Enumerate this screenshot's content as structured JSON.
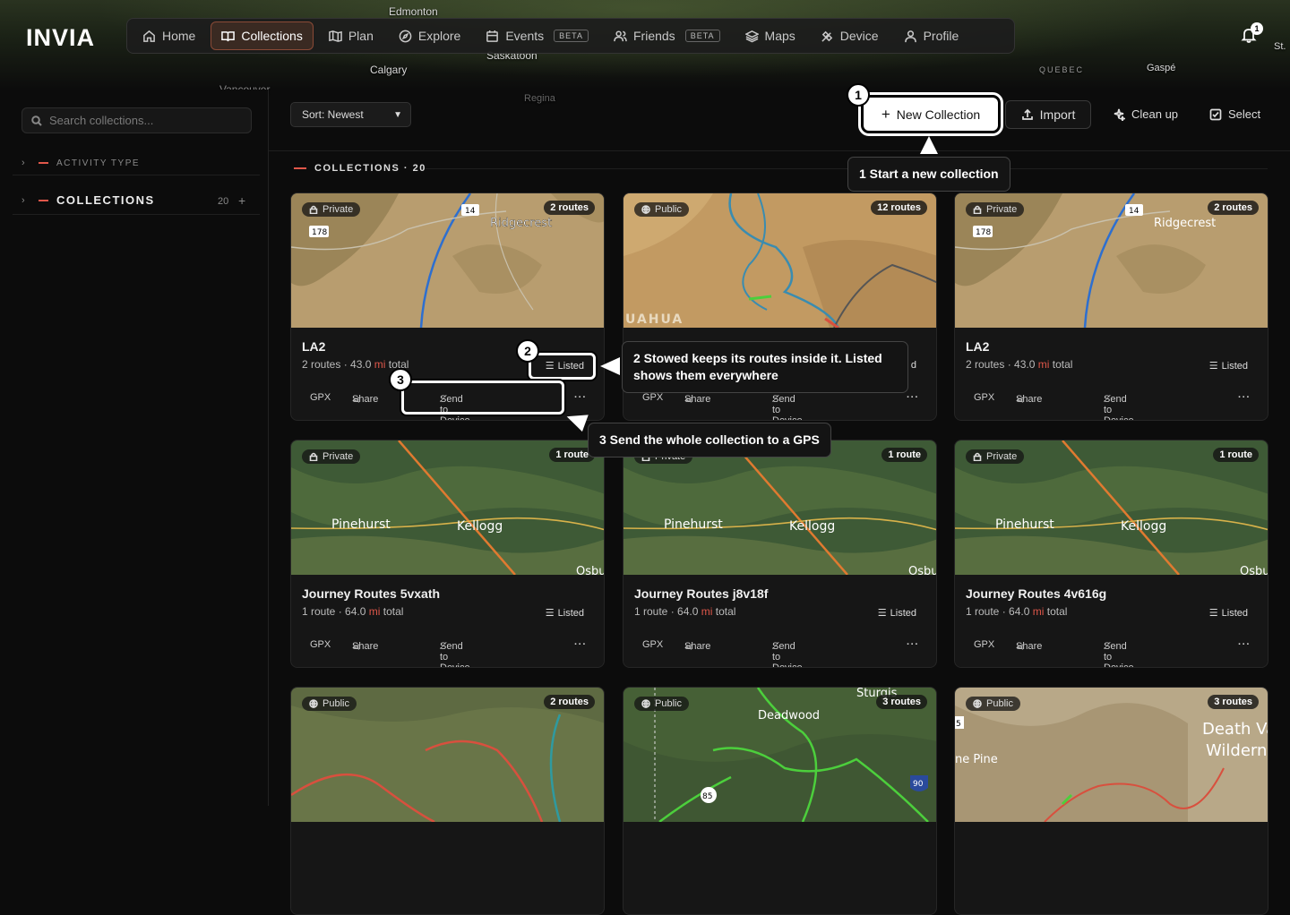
{
  "app": {
    "logo": "INVIA"
  },
  "map_places": [
    "Edmonton",
    "Saskatoon",
    "Calgary",
    "Vancouver",
    "Regina",
    "QUEBEC",
    "Gaspé",
    "St."
  ],
  "nav": [
    {
      "label": "Home",
      "icon": "home-icon"
    },
    {
      "label": "Collections",
      "icon": "book-icon",
      "active": true
    },
    {
      "label": "Plan",
      "icon": "map-icon"
    },
    {
      "label": "Explore",
      "icon": "compass-icon"
    },
    {
      "label": "Events",
      "icon": "calendar-icon",
      "badge": "BETA"
    },
    {
      "label": "Friends",
      "icon": "users-icon",
      "badge": "BETA"
    },
    {
      "label": "Maps",
      "icon": "layers-icon"
    },
    {
      "label": "Device",
      "icon": "satellite-icon"
    },
    {
      "label": "Profile",
      "icon": "user-icon"
    }
  ],
  "notifications": {
    "count": "1"
  },
  "sidebar": {
    "search_placeholder": "Search collections...",
    "activity_type": "ACTIVITY TYPE",
    "collections_label": "COLLECTIONS",
    "collections_count": "20",
    "add": "+"
  },
  "toolbar": {
    "sort": "Sort: Newest",
    "new_collection": "New Collection",
    "import": "Import",
    "clean_up": "Clean up",
    "select": "Select"
  },
  "section": {
    "title": "COLLECTIONS · 20"
  },
  "cards": [
    {
      "visibility": "Private",
      "routes": "2 routes",
      "title": "LA2",
      "count": "2 routes",
      "distance": "43.0",
      "unit": "mi",
      "suffix": "total",
      "listed": "Listed",
      "map": "desert"
    },
    {
      "visibility": "Public",
      "routes": "12 routes",
      "title": "",
      "count": "",
      "distance": "",
      "unit": "",
      "suffix": "",
      "listed": "d",
      "map": "canyon"
    },
    {
      "visibility": "Private",
      "routes": "2 routes",
      "title": "LA2",
      "count": "2 routes",
      "distance": "43.0",
      "unit": "mi",
      "suffix": "total",
      "listed": "Listed",
      "map": "desert"
    },
    {
      "visibility": "Private",
      "routes": "1 route",
      "title": "Journey Routes 5vxath",
      "count": "1 route",
      "distance": "64.0",
      "unit": "mi",
      "suffix": "total",
      "listed": "Listed",
      "map": "forest"
    },
    {
      "visibility": "Private",
      "routes": "1 route",
      "title": "Journey Routes j8v18f",
      "count": "1 route",
      "distance": "64.0",
      "unit": "mi",
      "suffix": "total",
      "listed": "Listed",
      "map": "forest"
    },
    {
      "visibility": "Private",
      "routes": "1 route",
      "title": "Journey Routes 4v616g",
      "count": "1 route",
      "distance": "64.0",
      "unit": "mi",
      "suffix": "total",
      "listed": "Listed",
      "map": "forest"
    },
    {
      "visibility": "Public",
      "routes": "2 routes",
      "title": "",
      "count": "",
      "distance": "",
      "unit": "",
      "suffix": "",
      "listed": "",
      "map": "mountain"
    },
    {
      "visibility": "Public",
      "routes": "3 routes",
      "title": "",
      "count": "",
      "distance": "",
      "unit": "",
      "suffix": "",
      "listed": "",
      "map": "greenforest"
    },
    {
      "visibility": "Public",
      "routes": "3 routes",
      "title": "",
      "count": "",
      "distance": "",
      "unit": "",
      "suffix": "",
      "listed": "",
      "map": "deathvalley"
    }
  ],
  "card_actions": {
    "gpx": "GPX",
    "share": "Share",
    "send": "Send to Device",
    "more": "···"
  },
  "map_labels": {
    "ridgecrest": "Ridgecrest",
    "hwy14": "14",
    "hwy178": "178",
    "pinehurst": "Pinehurst",
    "kellogg": "Kellogg",
    "osb": "Osbu",
    "uahua": "UAHUA",
    "sturgis": "Sturgis",
    "deadwood": "Deadwood",
    "hwy85": "85",
    "hwy90": "90",
    "deathvalley": "Death Va",
    "wildern": "Wildern",
    "lonepine": "ne Pine",
    "hwy5": "5"
  },
  "tour": {
    "step1_num": "1",
    "step1_text": "1 Start a new collection",
    "step2_num": "2",
    "step2_text": "2 Stowed keeps its routes inside it. Listed shows them everywhere",
    "step3_num": "3",
    "step3_text": "3 Send the whole collection to a GPS"
  },
  "colors": {
    "accent": "#e0574a",
    "highlight": "#ffffff",
    "route_blue": "#2d6fd0",
    "route_orange": "#e07a30",
    "route_red": "#d8503e",
    "route_green": "#4ccf3c"
  }
}
